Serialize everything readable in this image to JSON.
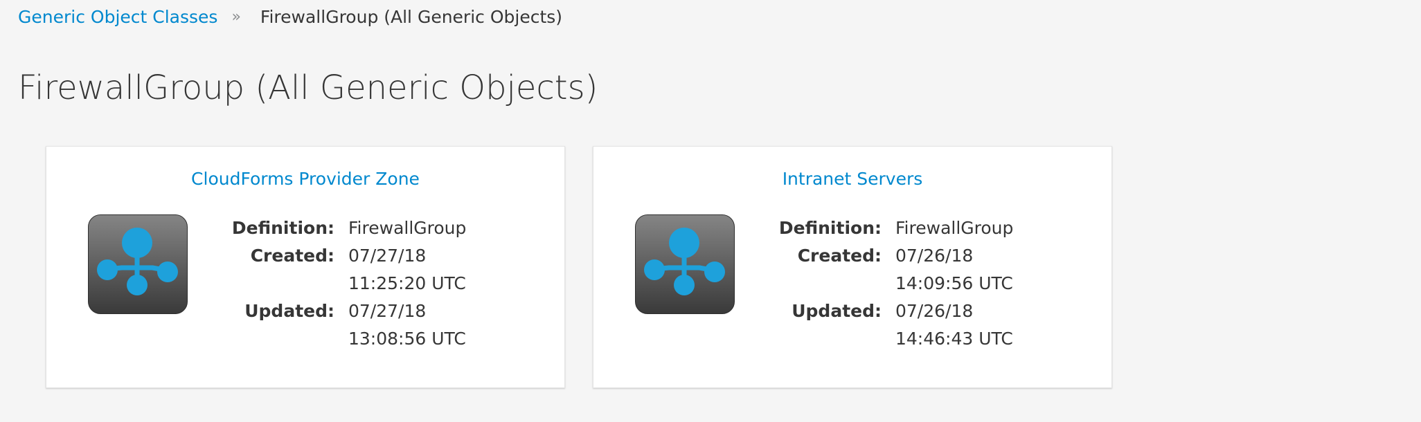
{
  "breadcrumb": {
    "parent_label": "Generic Object Classes",
    "separator": "»",
    "current_label": "FirewallGroup (All Generic Objects)"
  },
  "page": {
    "title": "FirewallGroup (All Generic Objects)"
  },
  "labels": {
    "definition": "Definition:",
    "created": "Created:",
    "updated": "Updated:"
  },
  "cards": [
    {
      "title": "CloudForms Provider Zone",
      "icon": "generic-object-icon",
      "definition": "FirewallGroup",
      "created": "07/27/18 11:25:20 UTC",
      "updated": "07/27/18 13:08:56 UTC"
    },
    {
      "title": "Intranet Servers",
      "icon": "generic-object-icon",
      "definition": "FirewallGroup",
      "created": "07/26/18 14:09:56 UTC",
      "updated": "07/26/18 14:46:43 UTC"
    }
  ],
  "colors": {
    "link": "#0088ce",
    "icon_accent": "#1ea1db",
    "background": "#f5f5f5"
  }
}
